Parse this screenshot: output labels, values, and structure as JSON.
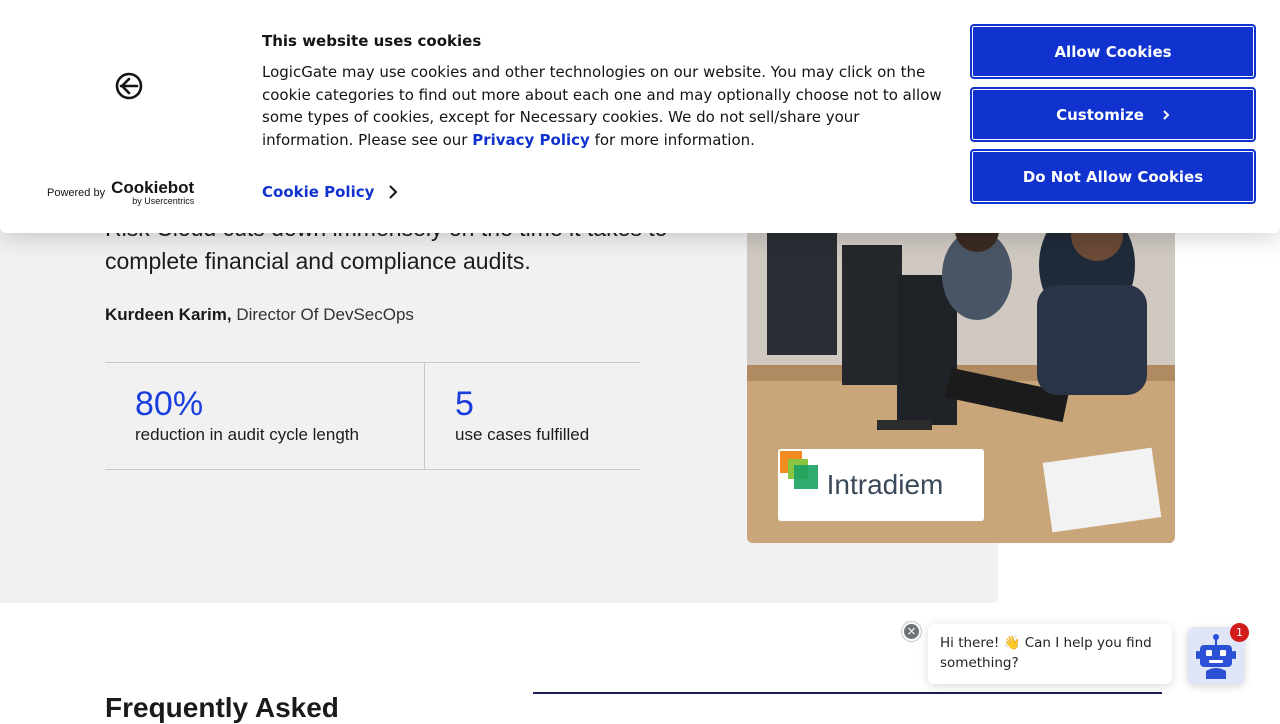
{
  "testimonial": {
    "quote": "Risk Cloud cuts down immensely on the time it takes to complete financial and compliance audits.",
    "author_name": "Kurdeen Karim,",
    "author_title": "Director Of DevSecOps",
    "stats": [
      {
        "value": "80%",
        "label": "reduction in audit cycle length"
      },
      {
        "value": "5",
        "label": "use cases fulfilled"
      }
    ],
    "customer_logo": "Intradiem"
  },
  "faq": {
    "title": "Frequently Asked"
  },
  "cookie_banner": {
    "title": "This website uses cookies",
    "text_before_link": "LogicGate may use cookies and other technologies on our website. You may click on the cookie categories to find out more about each one and may optionally choose not to allow some types of cookies, except for Necessary cookies.  We do not sell/share your information. Please see our ",
    "privacy_link": "Privacy Policy",
    "text_after_link": " for more information.",
    "cookie_policy_link": "Cookie Policy",
    "powered_by": "Powered by",
    "cookiebot_word": "Cookiebot",
    "cookiebot_sub": "by Usercentrics",
    "buttons": {
      "allow": "Allow Cookies",
      "customize": "Customize",
      "deny": "Do Not Allow Cookies"
    },
    "accent_color": "#1032cf"
  },
  "chat": {
    "greeting": "Hi there! 👋 Can I help you find something?",
    "badge_count": "1",
    "close_symbol": "×"
  },
  "icons": {
    "cookie_logo": "cookiebot-logo-icon",
    "chevron": "chevron-right-icon",
    "bot": "robot-icon"
  }
}
